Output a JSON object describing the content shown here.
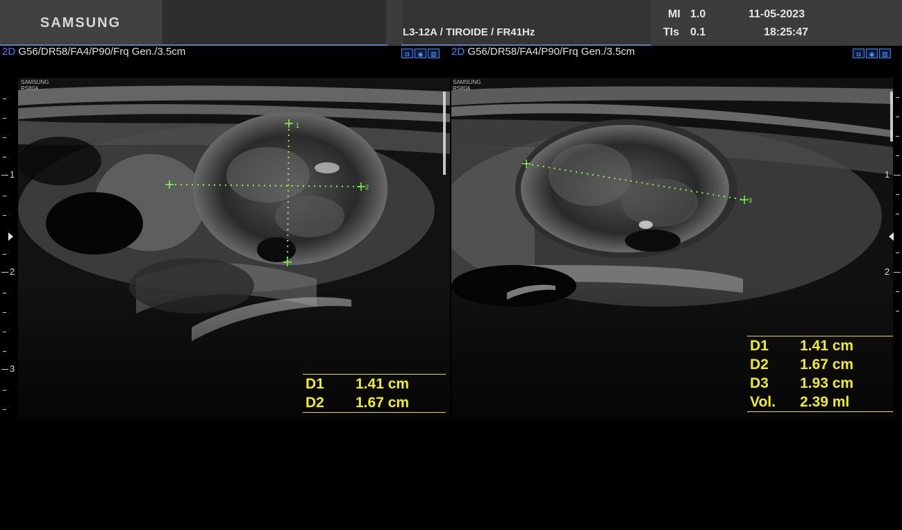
{
  "header": {
    "brand": "SAMSUNG",
    "probe_info": "L3-12A / TIROIDE / FR41Hz",
    "mi_label": "MI",
    "mi_value": "1.0",
    "tis_label": "TIs",
    "tis_value": "0.1",
    "date": "11-05-2023",
    "time": "18:25:47"
  },
  "left_pane": {
    "mode": "2D",
    "params": "G56/DR58/FA4/P90/Frq Gen./3.5cm",
    "watermark_line1": "SAMSUNG",
    "watermark_line2": "RS80A",
    "cursor_labels": [
      "1",
      "2"
    ],
    "measurements": [
      {
        "label": "D1",
        "value": "1.41 cm"
      },
      {
        "label": "D2",
        "value": "1.67 cm"
      }
    ]
  },
  "right_pane": {
    "mode": "2D",
    "params": "G56/DR58/FA4/P90/Frq Gen./3.5cm",
    "watermark_line1": "SAMSUNG",
    "watermark_line2": "RS80A",
    "cursor_labels": [
      "3"
    ],
    "measurements": [
      {
        "label": "D1",
        "value": "1.41 cm"
      },
      {
        "label": "D2",
        "value": "1.67 cm"
      },
      {
        "label": "D3",
        "value": "1.93 cm"
      },
      {
        "label": "Vol.",
        "value": "2.39 ml"
      }
    ]
  },
  "depth_scale": {
    "left": [
      "1",
      "2",
      "3"
    ],
    "right": [
      "1",
      "2"
    ]
  },
  "colors": {
    "measurement": "#f2ee1a",
    "caliper": "#7dff4a",
    "mode_blue": "#3d86ff",
    "header_bg": "#3c3c3c"
  },
  "icons": [
    "probe-settings-icon",
    "body-marker-icon",
    "annotation-icon"
  ]
}
